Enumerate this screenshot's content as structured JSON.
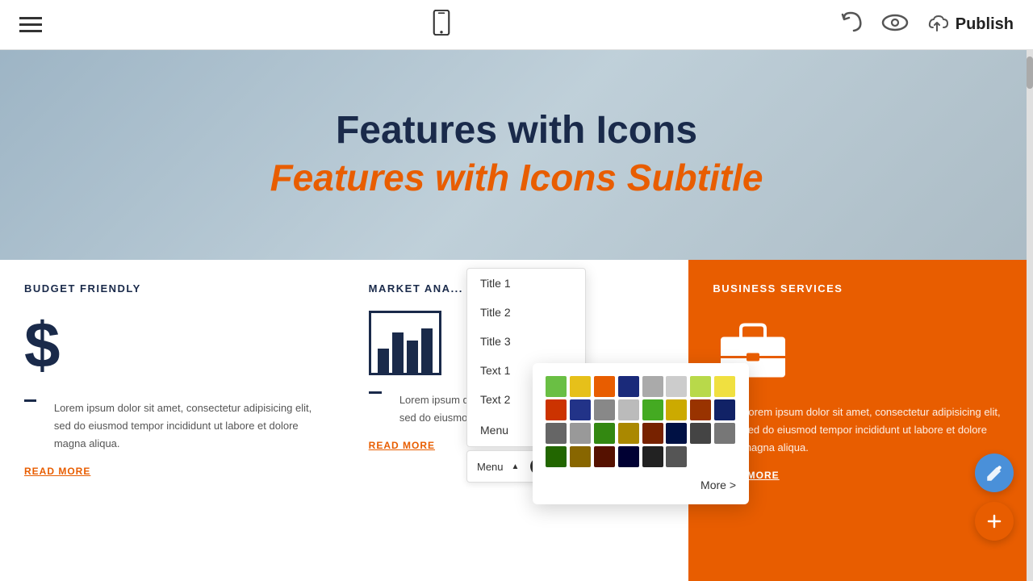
{
  "toolbar": {
    "publish_label": "Publish"
  },
  "hero": {
    "title": "Features with Icons",
    "subtitle": "Features with Icons Subtitle"
  },
  "cards": [
    {
      "title": "BUDGET FRIENDLY",
      "icon_type": "dollar",
      "text": "Lorem ipsum dolor sit amet, consectetur adipisicing elit, sed do eiusmod tempor incididunt ut labore et dolore magna aliqua.",
      "link": "READ MORE"
    },
    {
      "title": "MARKET ANA...",
      "icon_type": "chart",
      "text": "Lorem ipsum dolor sit amet, consectetur adipisicing elit, sed do eiusmod tempor incididunt ut labore et dolore m...",
      "link": "READ MORE"
    },
    {
      "title": "BUSINESS SERVICES",
      "icon_type": "briefcase",
      "text": "Lorem ipsum dolor sit amet, consectetur adipisicing elit, sed do eiusmod tempor incididunt ut labore et dolore magna aliqua.",
      "link": "READ MORE"
    }
  ],
  "dropdown": {
    "items": [
      {
        "label": "Title 1"
      },
      {
        "label": "Title 2"
      },
      {
        "label": "Title 3"
      },
      {
        "label": "Text 1"
      },
      {
        "label": "Text 2"
      },
      {
        "label": "Menu",
        "has_edit": true
      }
    ],
    "menu_label": "Menu",
    "chevron": "▲"
  },
  "color_picker": {
    "colors": [
      "#6abf44",
      "#e6c01a",
      "#e85d00",
      "#1a2a7a",
      "#aaaaaa",
      "#cccccc",
      "#b8d94a",
      "#f0e040",
      "#cc3300",
      "#223388",
      "#888888",
      "#bbbbbb",
      "#44aa22",
      "#ccaa00",
      "#993300",
      "#112266",
      "#666666",
      "#999999",
      "#338811",
      "#aa8800",
      "#772200",
      "#001144",
      "#444444",
      "#777777",
      "#226600",
      "#886600",
      "#551100",
      "#000033",
      "#222222",
      "#555555"
    ],
    "more_label": "More >"
  }
}
